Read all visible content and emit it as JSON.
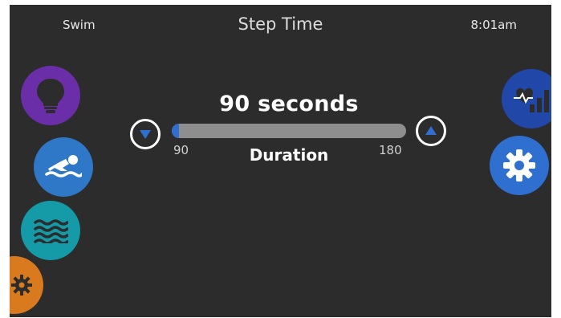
{
  "header": {
    "mode": "Swim",
    "title": "Step Time",
    "time": "8:01am"
  },
  "setting": {
    "value_text": "90 seconds",
    "label": "Duration",
    "min": 90,
    "max": 180,
    "current": 90,
    "min_label": "90",
    "max_label": "180"
  },
  "icons": {
    "left": [
      "lightbulb-icon",
      "swimmer-icon",
      "waves-icon",
      "gear-icon"
    ],
    "right": [
      "heart-stats-icon",
      "gear-icon"
    ],
    "arrows": [
      "chevron-down-icon",
      "chevron-up-icon"
    ]
  },
  "colors": {
    "background": "#2c2c2c",
    "light_button": "#6a2fa8",
    "swim_button": "#2f78c8",
    "waves_button": "#159aa8",
    "orange_button": "#d97a1e",
    "stats_button": "#2148a8",
    "settings_button": "#2e6fd0",
    "track": "#8e8e8e",
    "track_fill": "#2f6fd0"
  }
}
